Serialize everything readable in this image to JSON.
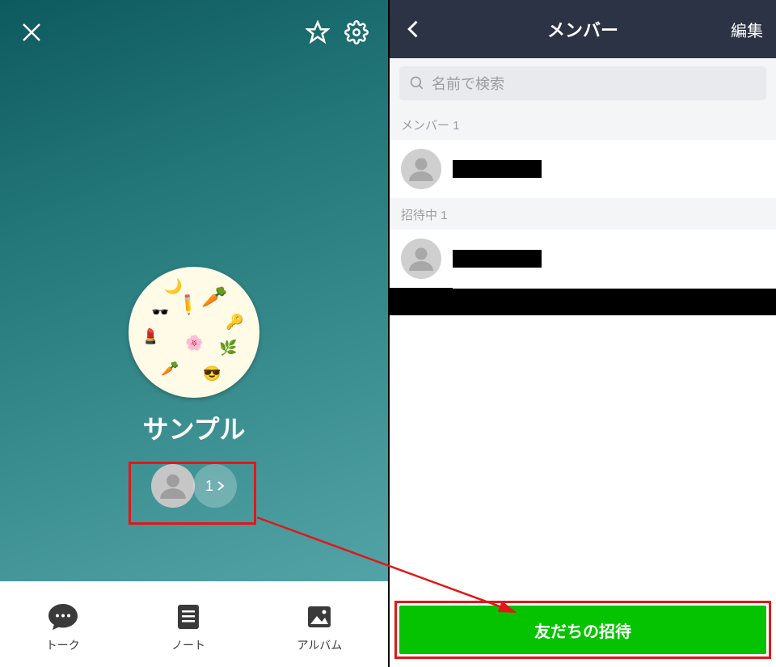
{
  "left": {
    "group_name": "サンプル",
    "member_count_label": "1",
    "bottom": {
      "talk": "トーク",
      "note": "ノート",
      "album": "アルバム"
    }
  },
  "right": {
    "header": {
      "title": "メンバー",
      "edit": "編集"
    },
    "search": {
      "placeholder": "名前で検索"
    },
    "sections": {
      "members_label": "メンバー 1",
      "inviting_label": "招待中 1"
    },
    "invite_button": "友だちの招待"
  }
}
